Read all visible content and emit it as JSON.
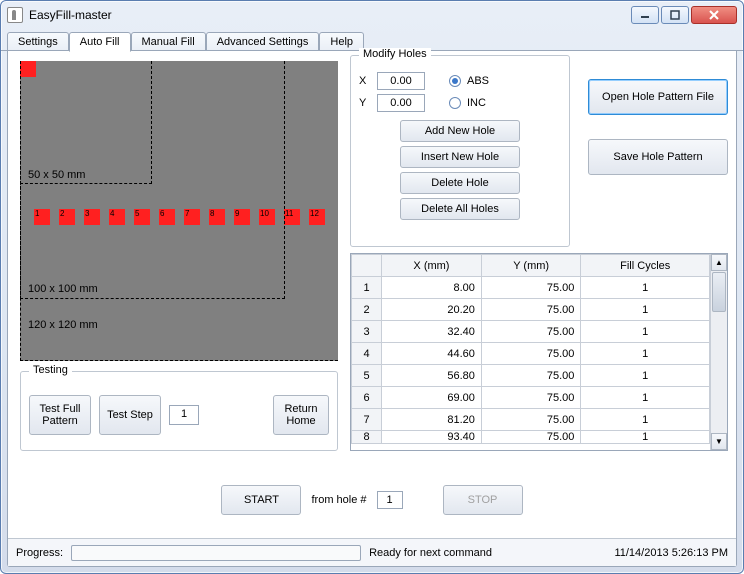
{
  "window": {
    "title": "EasyFill-master"
  },
  "tabs": [
    "Settings",
    "Auto Fill",
    "Manual Fill",
    "Advanced Settings",
    "Help"
  ],
  "active_tab": 1,
  "preview": {
    "sizes": [
      "50 x 50 mm",
      "100 x 100 mm",
      "120 x 120 mm"
    ],
    "markers": [
      1,
      2,
      3,
      4,
      5,
      6,
      7,
      8,
      9,
      10,
      11,
      12
    ]
  },
  "testing": {
    "legend": "Testing",
    "test_full": "Test Full Pattern",
    "test_step": "Test Step",
    "step_value": "1",
    "return_home": "Return Home"
  },
  "modify": {
    "legend": "Modify Holes",
    "x_label": "X",
    "y_label": "Y",
    "x_value": "0.00",
    "y_value": "0.00",
    "mode_abs": "ABS",
    "mode_inc": "INC",
    "mode_selected": "ABS",
    "add": "Add New Hole",
    "insert": "Insert New Hole",
    "delete": "Delete Hole",
    "delete_all": "Delete All Holes"
  },
  "right": {
    "open": "Open Hole Pattern File",
    "save": "Save Hole Pattern"
  },
  "table": {
    "headers": [
      "",
      "X (mm)",
      "Y (mm)",
      "Fill Cycles"
    ],
    "rows": [
      {
        "n": "1",
        "x": "8.00",
        "y": "75.00",
        "f": "1"
      },
      {
        "n": "2",
        "x": "20.20",
        "y": "75.00",
        "f": "1"
      },
      {
        "n": "3",
        "x": "32.40",
        "y": "75.00",
        "f": "1"
      },
      {
        "n": "4",
        "x": "44.60",
        "y": "75.00",
        "f": "1"
      },
      {
        "n": "5",
        "x": "56.80",
        "y": "75.00",
        "f": "1"
      },
      {
        "n": "6",
        "x": "69.00",
        "y": "75.00",
        "f": "1"
      },
      {
        "n": "7",
        "x": "81.20",
        "y": "75.00",
        "f": "1"
      },
      {
        "n": "8",
        "x": "93.40",
        "y": "75.00",
        "f": "1"
      }
    ]
  },
  "run": {
    "start": "START",
    "from_label": "from hole #",
    "from_value": "1",
    "stop": "STOP"
  },
  "status": {
    "progress_label": "Progress:",
    "message": "Ready for next command",
    "timestamp": "11/14/2013 5:26:13 PM"
  }
}
